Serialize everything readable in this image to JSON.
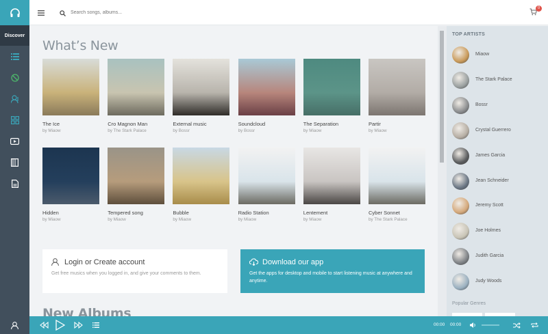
{
  "sidebar": {
    "logo_icon": "headphones-icon",
    "discover_label": "Discover",
    "items": [
      {
        "icon": "list-icon"
      },
      {
        "icon": "disc-icon"
      },
      {
        "icon": "artist-icon"
      },
      {
        "icon": "grid-icon"
      },
      {
        "icon": "video-icon"
      },
      {
        "icon": "book-icon"
      },
      {
        "icon": "file-icon"
      }
    ],
    "bottom_icon": "user-icon"
  },
  "topbar": {
    "search_placeholder": "Search songs, albums...",
    "cart_count": "0"
  },
  "main": {
    "whats_new_title": "What’s New",
    "albums": [
      {
        "title": "The Ice",
        "artist": "by Miaow",
        "colors": [
          "#d8dcd8",
          "#c9b27a",
          "#8a7a5a"
        ]
      },
      {
        "title": "Cro Magnon Man",
        "artist": "by The Stark Palace",
        "colors": [
          "#a9c2c0",
          "#c8c4b0",
          "#6d6a5e"
        ]
      },
      {
        "title": "External music",
        "artist": "by Bossr",
        "colors": [
          "#e4e2dc",
          "#b8b4ac",
          "#2f2c28"
        ]
      },
      {
        "title": "Soundcloud",
        "artist": "by Bossr",
        "colors": [
          "#a9c9d6",
          "#b7867c",
          "#6a3f45"
        ]
      },
      {
        "title": "The Separation",
        "artist": "by Miaow",
        "colors": [
          "#4e8a80",
          "#5c9488",
          "#466e66"
        ]
      },
      {
        "title": "Partir",
        "artist": "by Miaow",
        "colors": [
          "#c9c6c2",
          "#b2aca6",
          "#7c7570"
        ]
      },
      {
        "title": "Hidden",
        "artist": "by Miaow",
        "colors": [
          "#1c3550",
          "#243f5c",
          "#4b5a6b"
        ]
      },
      {
        "title": "Tempered song",
        "artist": "by Miaow",
        "colors": [
          "#9a9488",
          "#b69c7c",
          "#5e4e3c"
        ]
      },
      {
        "title": "Bubble",
        "artist": "by Miaow",
        "colors": [
          "#c8d8e4",
          "#d8c48a",
          "#a88c4a"
        ]
      },
      {
        "title": "Radio Station",
        "artist": "by Miaow",
        "colors": [
          "#f2f2f2",
          "#d9e4ea",
          "#6b6a62"
        ]
      },
      {
        "title": "Lentement",
        "artist": "by Miaow",
        "colors": [
          "#e8e6e4",
          "#c9c5c2",
          "#4a4644"
        ]
      },
      {
        "title": "Cyber Sonnet",
        "artist": "by The Stark Palace",
        "colors": [
          "#f2f2f2",
          "#d9e4ea",
          "#6b6a62"
        ]
      }
    ],
    "login_panel": {
      "title": "Login or Create account",
      "text": "Get free musics when you logged in, and give your comments to them."
    },
    "app_panel": {
      "title": "Download our app",
      "text": "Get the apps for desktop and mobile to start listening music at anywhere and anytime."
    },
    "new_albums_title": "New Albums"
  },
  "right_sidebar": {
    "top_artists_title": "TOP ARTISTS",
    "artists": [
      {
        "name": "Miaow",
        "color": "#c99a5a"
      },
      {
        "name": "The Stark Palace",
        "color": "#9aa0a0"
      },
      {
        "name": "Bossr",
        "color": "#8a8c8e"
      },
      {
        "name": "Crystal Guerrero",
        "color": "#b6aea4"
      },
      {
        "name": "James Garcia",
        "color": "#5a5c5e"
      },
      {
        "name": "Jean Schneider",
        "color": "#6a7684"
      },
      {
        "name": "Jeremy Scott",
        "color": "#d4a87a"
      },
      {
        "name": "Joe Holmes",
        "color": "#c8c4b6"
      },
      {
        "name": "Judith Garcia",
        "color": "#7e8286"
      },
      {
        "name": "Judy Woods",
        "color": "#9ab0c0"
      }
    ],
    "popular_genres_title": "Popular Genres"
  },
  "player": {
    "current_time": "00:00",
    "duration": "00:00"
  },
  "colors": {
    "accent": "#3aa5b8",
    "rail": "#414f5c",
    "badge": "#e0534a"
  }
}
